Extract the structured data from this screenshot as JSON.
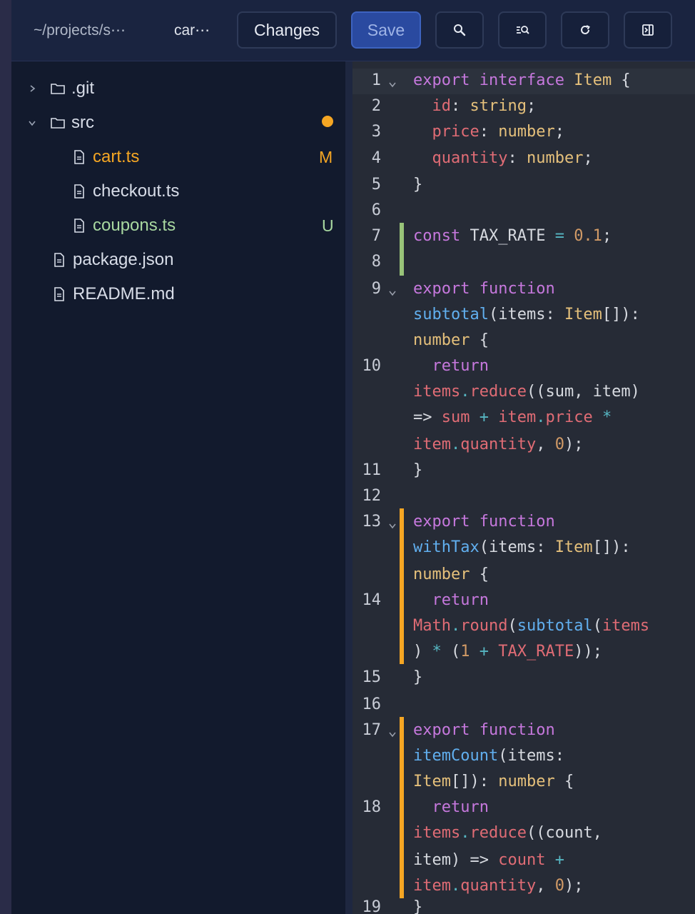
{
  "header": {
    "path": "~/projects/s⋯",
    "file": "car⋯",
    "changes_label": "Changes",
    "save_label": "Save",
    "icons": [
      "search-icon",
      "search-in-files-icon",
      "refresh-icon",
      "toggle-panel-icon"
    ]
  },
  "tree": {
    "git": ".git",
    "src": "src",
    "src_status": "modified-dot",
    "cart": "cart.ts",
    "cart_status": "M",
    "checkout": "checkout.ts",
    "coupons": "coupons.ts",
    "coupons_status": "U",
    "package": "package.json",
    "readme": "README.md"
  },
  "colors": {
    "modified": "#f5a623",
    "untracked": "#a8d8a0",
    "added_bar": "#98c379",
    "changed_bar": "#f5a623"
  },
  "editor": {
    "line_numbers": [
      "1",
      "2",
      "3",
      "4",
      "5",
      "6",
      "7",
      "8",
      "9",
      "10",
      "11",
      "12",
      "13",
      "14",
      "15",
      "16",
      "17",
      "18",
      "19"
    ],
    "code": {
      "l1": [
        {
          "t": "export",
          "c": "kw"
        },
        {
          "t": " "
        },
        {
          "t": "interface",
          "c": "kw"
        },
        {
          "t": " "
        },
        {
          "t": "Item",
          "c": "ty"
        },
        {
          "t": " {"
        }
      ],
      "l2": [
        {
          "t": "  "
        },
        {
          "t": "id",
          "c": "pr"
        },
        {
          "t": ": "
        },
        {
          "t": "string",
          "c": "ty"
        },
        {
          "t": ";"
        }
      ],
      "l3": [
        {
          "t": "  "
        },
        {
          "t": "price",
          "c": "pr"
        },
        {
          "t": ": "
        },
        {
          "t": "number",
          "c": "ty"
        },
        {
          "t": ";"
        }
      ],
      "l4": [
        {
          "t": "  "
        },
        {
          "t": "quantity",
          "c": "pr"
        },
        {
          "t": ": "
        },
        {
          "t": "number",
          "c": "ty"
        },
        {
          "t": ";"
        }
      ],
      "l5": [
        {
          "t": "}"
        }
      ],
      "l7": [
        {
          "t": "const",
          "c": "kw"
        },
        {
          "t": " TAX_RATE "
        },
        {
          "t": "=",
          "c": "op"
        },
        {
          "t": " "
        },
        {
          "t": "0.1",
          "c": "nu"
        },
        {
          "t": ";"
        }
      ],
      "l9a": [
        {
          "t": "export",
          "c": "kw"
        },
        {
          "t": " "
        },
        {
          "t": "function",
          "c": "kw"
        }
      ],
      "l9b": [
        {
          "t": "subtotal",
          "c": "fn"
        },
        {
          "t": "(items: "
        },
        {
          "t": "Item",
          "c": "ty"
        },
        {
          "t": "[]):"
        }
      ],
      "l9c": [
        {
          "t": "number",
          "c": "ty"
        },
        {
          "t": " {"
        }
      ],
      "l10a": [
        {
          "t": "  "
        },
        {
          "t": "return",
          "c": "kw"
        }
      ],
      "l10b": [
        {
          "t": "items",
          "c": "pr"
        },
        {
          "t": ".",
          "c": "op"
        },
        {
          "t": "reduce",
          "c": "pr"
        },
        {
          "t": "((sum, item)"
        }
      ],
      "l10c": [
        {
          "t": "=> "
        },
        {
          "t": "sum",
          "c": "pr"
        },
        {
          "t": " "
        },
        {
          "t": "+",
          "c": "op"
        },
        {
          "t": " "
        },
        {
          "t": "item",
          "c": "pr"
        },
        {
          "t": ".",
          "c": "op"
        },
        {
          "t": "price",
          "c": "pr"
        },
        {
          "t": " "
        },
        {
          "t": "*",
          "c": "op"
        }
      ],
      "l10d": [
        {
          "t": "item",
          "c": "pr"
        },
        {
          "t": ".",
          "c": "op"
        },
        {
          "t": "quantity",
          "c": "pr"
        },
        {
          "t": ", "
        },
        {
          "t": "0",
          "c": "nu"
        },
        {
          "t": ");"
        }
      ],
      "l11": [
        {
          "t": "}"
        }
      ],
      "l13a": [
        {
          "t": "export",
          "c": "kw"
        },
        {
          "t": " "
        },
        {
          "t": "function",
          "c": "kw"
        }
      ],
      "l13b": [
        {
          "t": "withTax",
          "c": "fn"
        },
        {
          "t": "(items: "
        },
        {
          "t": "Item",
          "c": "ty"
        },
        {
          "t": "[]):"
        }
      ],
      "l13c": [
        {
          "t": "number",
          "c": "ty"
        },
        {
          "t": " {"
        }
      ],
      "l14a": [
        {
          "t": "  "
        },
        {
          "t": "return",
          "c": "kw"
        }
      ],
      "l14b": [
        {
          "t": "Math",
          "c": "pr"
        },
        {
          "t": ".",
          "c": "op"
        },
        {
          "t": "round",
          "c": "pr"
        },
        {
          "t": "("
        },
        {
          "t": "subtotal",
          "c": "fn"
        },
        {
          "t": "("
        },
        {
          "t": "items",
          "c": "pr"
        }
      ],
      "l14c": [
        {
          "t": ") "
        },
        {
          "t": "*",
          "c": "op"
        },
        {
          "t": " ("
        },
        {
          "t": "1",
          "c": "nu"
        },
        {
          "t": " "
        },
        {
          "t": "+",
          "c": "op"
        },
        {
          "t": " "
        },
        {
          "t": "TAX_RATE",
          "c": "pr"
        },
        {
          "t": "));"
        }
      ],
      "l15": [
        {
          "t": "}"
        }
      ],
      "l17a": [
        {
          "t": "export",
          "c": "kw"
        },
        {
          "t": " "
        },
        {
          "t": "function",
          "c": "kw"
        }
      ],
      "l17b": [
        {
          "t": "itemCount",
          "c": "fn"
        },
        {
          "t": "(items:"
        }
      ],
      "l17c": [
        {
          "t": "Item",
          "c": "ty"
        },
        {
          "t": "[]): "
        },
        {
          "t": "number",
          "c": "ty"
        },
        {
          "t": " {"
        }
      ],
      "l18a": [
        {
          "t": "  "
        },
        {
          "t": "return",
          "c": "kw"
        }
      ],
      "l18b": [
        {
          "t": "items",
          "c": "pr"
        },
        {
          "t": ".",
          "c": "op"
        },
        {
          "t": "reduce",
          "c": "pr"
        },
        {
          "t": "((count,"
        }
      ],
      "l18c": [
        {
          "t": "item) => "
        },
        {
          "t": "count",
          "c": "pr"
        },
        {
          "t": " "
        },
        {
          "t": "+",
          "c": "op"
        }
      ],
      "l18d": [
        {
          "t": "item",
          "c": "pr"
        },
        {
          "t": ".",
          "c": "op"
        },
        {
          "t": "quantity",
          "c": "pr"
        },
        {
          "t": ", "
        },
        {
          "t": "0",
          "c": "nu"
        },
        {
          "t": ");"
        }
      ],
      "l19": [
        {
          "t": "}"
        }
      ]
    }
  }
}
